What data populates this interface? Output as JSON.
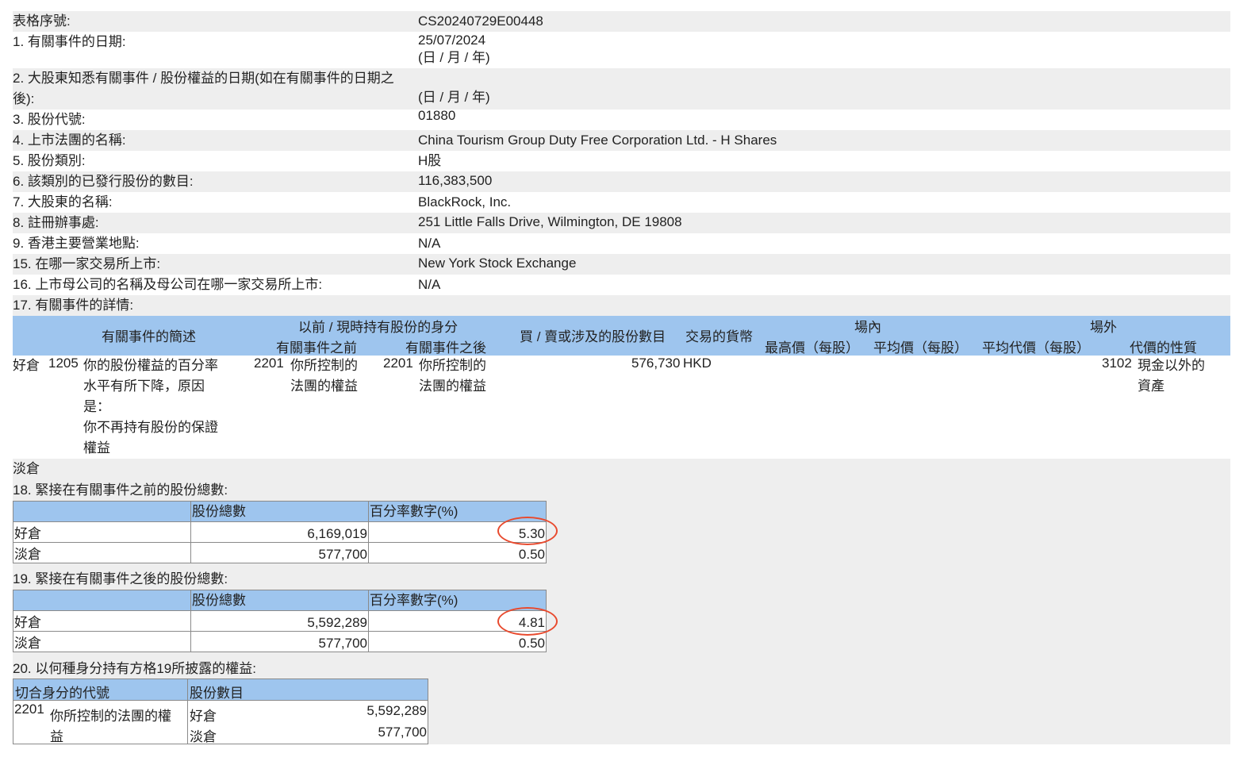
{
  "form": {
    "serial_label": "表格序號:",
    "serial_value": "CS20240729E00448",
    "q1_label": "1. 有關事件的日期:",
    "q1_value": "25/07/2024",
    "q1_hint": "(日 / 月 / 年)",
    "q2_label_a": "2. 大股東知悉有關事件 / 股份權益的日期(如在有關事件的日期之",
    "q2_label_b": "後):",
    "q2_hint": "(日 / 月 / 年)",
    "q3_label": "3. 股份代號:",
    "q3_value": "01880",
    "q4_label": "4. 上市法團的名稱:",
    "q4_value": "China Tourism Group Duty Free Corporation Ltd. - H Shares",
    "q5_label": "5. 股份類別:",
    "q5_value": "H股",
    "q6_label": "6. 該類別的已發行股份的數目:",
    "q6_value": "116,383,500",
    "q7_label": "7. 大股東的名稱:",
    "q7_value": "BlackRock, Inc.",
    "q8_label": "8. 註冊辦事處:",
    "q8_value": "251 Little Falls Drive, Wilmington, DE 19808",
    "q9_label": "9. 香港主要營業地點:",
    "q9_value": "N/A",
    "q15_label": "15. 在哪一家交易所上市:",
    "q15_value": "New York Stock Exchange",
    "q16_label": "16. 上市母公司的名稱及母公司在哪一家交易所上市:",
    "q16_value": "N/A",
    "q17_label": "17. 有關事件的詳情:"
  },
  "event_table": {
    "h_desc": "有關事件的簡述",
    "h_capacity": "以前 / 現時持有股份的身分",
    "h_before": "有關事件之前",
    "h_after": "有關事件之後",
    "h_shares": "買 / 賣或涉及的股份數目",
    "h_currency": "交易的貨幣",
    "h_onex": "場內",
    "h_onex_high": "最高價（每股）",
    "h_onex_avg": "平均價（每股）",
    "h_offex": "場外",
    "h_offex_avg": "平均代價（每股）",
    "h_offex_nature": "代價的性質",
    "long_label": "好倉",
    "code": "1205",
    "desc_1": "你的股份權益的百分率",
    "desc_2": "水平有所下降，原因",
    "desc_3": "是：",
    "desc_4": "你不再持有股份的保證",
    "desc_5": "權益",
    "before_code": "2201",
    "before_1": "你所控制的",
    "before_2": "法團的權益",
    "after_code": "2201",
    "after_1": "你所控制的",
    "after_2": "法團的權益",
    "shares": "576,730",
    "currency": "HKD",
    "nature_code": "3102",
    "nature_1": "現金以外的",
    "nature_2": "資產",
    "short_label": "淡倉"
  },
  "q18": {
    "label": "18. 緊接在有關事件之前的股份總數:",
    "h_total": "股份總數",
    "h_pct": "百分率數字(%)",
    "long_label": "好倉",
    "long_total": "6,169,019",
    "long_pct": "5.30",
    "short_label": "淡倉",
    "short_total": "577,700",
    "short_pct": "0.50"
  },
  "q19": {
    "label": "19. 緊接在有關事件之後的股份總數:",
    "h_total": "股份總數",
    "h_pct": "百分率數字(%)",
    "long_label": "好倉",
    "long_total": "5,592,289",
    "long_pct": "4.81",
    "short_label": "淡倉",
    "short_total": "577,700",
    "short_pct": "0.50"
  },
  "q20": {
    "label": "20. 以何種身分持有方格19所披露的權益:",
    "h_code": "切合身分的代號",
    "h_shares": "股份數目",
    "code": "2201",
    "cap_1": "你所控制的法團的權",
    "cap_2": "益",
    "long_label": "好倉",
    "long_value": "5,592,289",
    "short_label": "淡倉",
    "short_value": "577,700"
  },
  "colors": {
    "header_blue": "#9ec5ee",
    "row_grey": "#eeeeee",
    "annotation_red": "#e84a2e"
  }
}
